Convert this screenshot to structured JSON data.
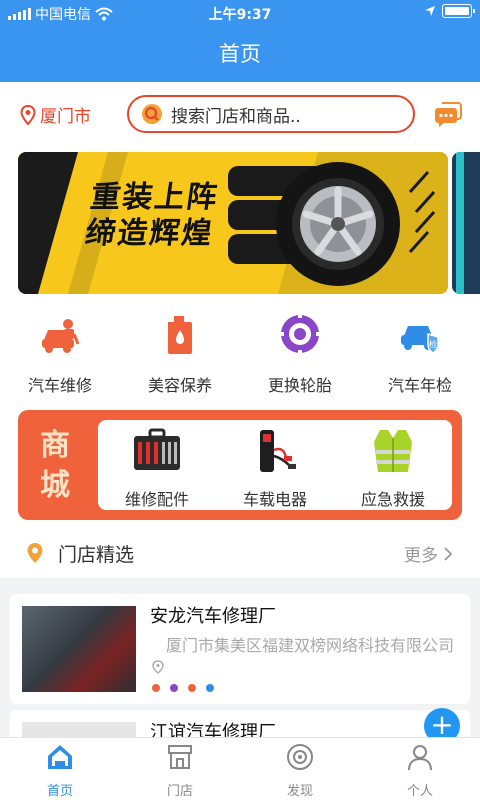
{
  "status": {
    "carrier": "中国电信",
    "time": "上午9:37"
  },
  "nav": {
    "title": "首页"
  },
  "location": {
    "city": "厦门市"
  },
  "search": {
    "placeholder": "搜索门店和商品.."
  },
  "banner": {
    "title_line1": "重装上阵",
    "title_line2": "缔造辉煌"
  },
  "categories": [
    {
      "label": "汽车维修",
      "icon": "car-repair-icon"
    },
    {
      "label": "美容保养",
      "icon": "oil-bottle-icon"
    },
    {
      "label": "更换轮胎",
      "icon": "tire-icon"
    },
    {
      "label": "汽车年检",
      "icon": "car-inspection-icon"
    }
  ],
  "mall": {
    "title": "商城",
    "items": [
      {
        "label": "维修配件",
        "icon": "toolkit-icon"
      },
      {
        "label": "车载电器",
        "icon": "jump-starter-icon"
      },
      {
        "label": "应急救援",
        "icon": "safety-vest-icon"
      }
    ]
  },
  "stores_section": {
    "title": "门店精选",
    "more": "更多"
  },
  "stores": [
    {
      "name": "安龙汽车修理厂",
      "address": "厦门市集美区福建双榜网络科技有限公司"
    },
    {
      "name": "江谊汽车修理厂"
    }
  ],
  "tabs": [
    {
      "label": "首页",
      "icon": "home-icon"
    },
    {
      "label": "门店",
      "icon": "store-icon"
    },
    {
      "label": "发现",
      "icon": "discover-icon"
    },
    {
      "label": "个人",
      "icon": "user-icon"
    }
  ],
  "colors": {
    "brand": "#3a95f0",
    "accent": "#e8452a",
    "mall": "#f0623c"
  }
}
